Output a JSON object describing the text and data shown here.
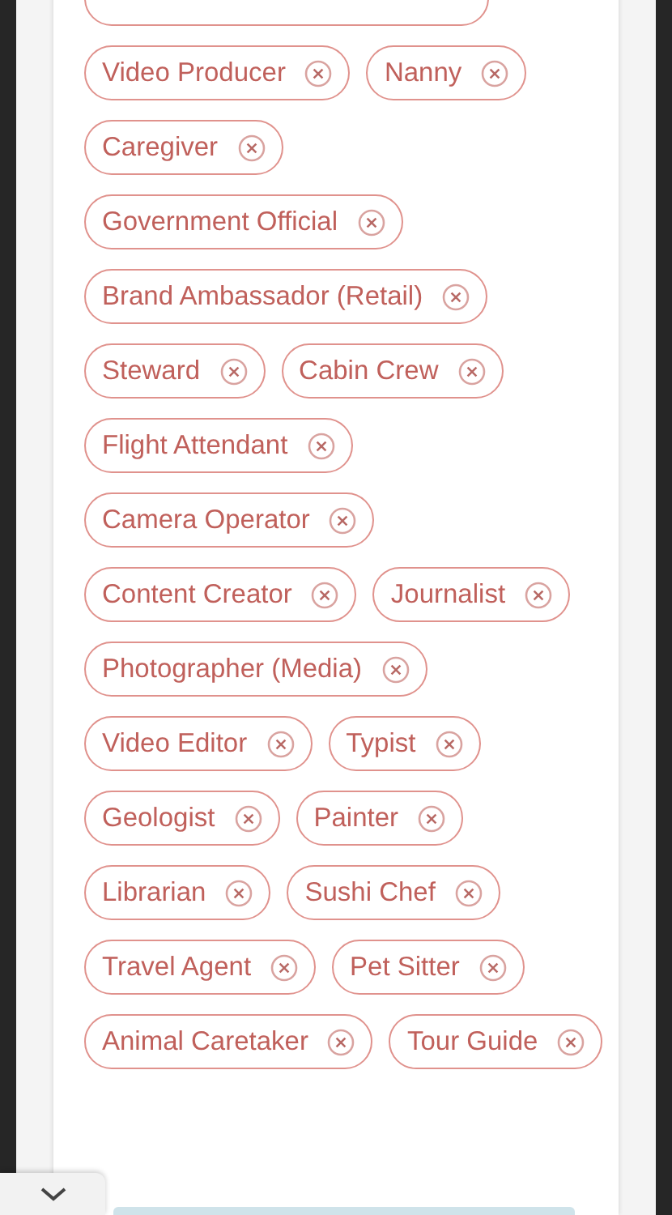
{
  "tags": [
    {
      "label": "Video Producer"
    },
    {
      "label": "Nanny"
    },
    {
      "label": "Caregiver"
    },
    {
      "label": "Government Official"
    },
    {
      "label": "Brand Ambassador (Retail)"
    },
    {
      "label": "Steward"
    },
    {
      "label": "Cabin Crew"
    },
    {
      "label": "Flight Attendant"
    },
    {
      "label": "Camera Operator"
    },
    {
      "label": "Content Creator"
    },
    {
      "label": "Journalist"
    },
    {
      "label": "Photographer (Media)"
    },
    {
      "label": "Video Editor"
    },
    {
      "label": "Typist"
    },
    {
      "label": "Geologist"
    },
    {
      "label": "Painter"
    },
    {
      "label": "Librarian"
    },
    {
      "label": "Sushi Chef"
    },
    {
      "label": "Travel Agent"
    },
    {
      "label": "Pet Sitter"
    },
    {
      "label": "Animal Caretaker"
    },
    {
      "label": "Tour Guide"
    }
  ]
}
